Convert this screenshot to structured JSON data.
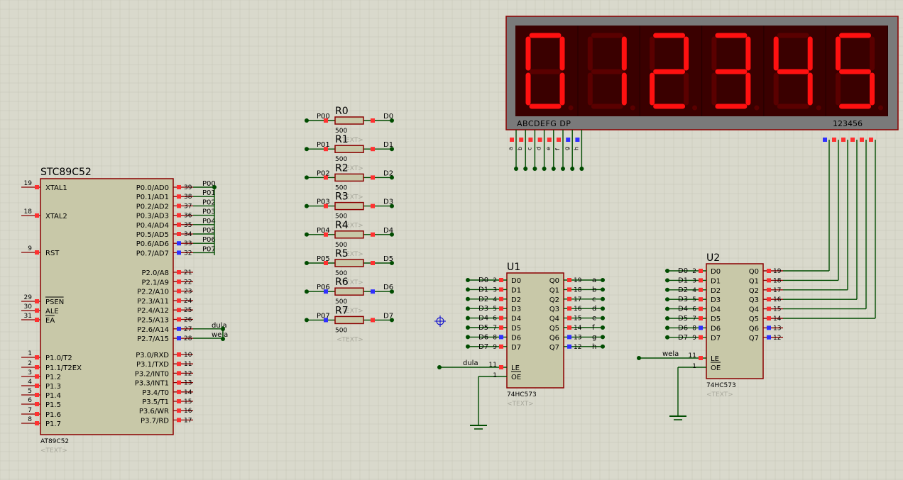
{
  "mcu": {
    "name": "STC89C52",
    "part": "AT89C52",
    "text": "<TEXT>",
    "left_pins": [
      {
        "num": "19",
        "label": "XTAL1"
      },
      {
        "num": "18",
        "label": "XTAL2"
      },
      {
        "num": "9",
        "label": "RST"
      },
      {
        "num": "29",
        "label": "PSEN",
        "overline": true
      },
      {
        "num": "30",
        "label": "ALE"
      },
      {
        "num": "31",
        "label": "EA",
        "overline": true
      },
      {
        "num": "1",
        "label": "P1.0/T2"
      },
      {
        "num": "2",
        "label": "P1.1/T2EX"
      },
      {
        "num": "3",
        "label": "P1.2"
      },
      {
        "num": "4",
        "label": "P1.3"
      },
      {
        "num": "5",
        "label": "P1.4"
      },
      {
        "num": "6",
        "label": "P1.5"
      },
      {
        "num": "7",
        "label": "P1.6"
      },
      {
        "num": "8",
        "label": "P1.7"
      }
    ],
    "right_pins": [
      {
        "num": "39",
        "label": "P0.0/AD0",
        "net": "P00"
      },
      {
        "num": "38",
        "label": "P0.1/AD1",
        "net": "P01"
      },
      {
        "num": "37",
        "label": "P0.2/AD2",
        "net": "P02"
      },
      {
        "num": "36",
        "label": "P0.3/AD3",
        "net": "P03"
      },
      {
        "num": "35",
        "label": "P0.4/AD4",
        "net": "P04"
      },
      {
        "num": "34",
        "label": "P0.5/AD5",
        "net": "P05"
      },
      {
        "num": "33",
        "label": "P0.6/AD6",
        "net": "P06"
      },
      {
        "num": "32",
        "label": "P0.7/AD7",
        "net": "P07"
      },
      {
        "num": "21",
        "label": "P2.0/A8",
        "net": ""
      },
      {
        "num": "22",
        "label": "P2.1/A9",
        "net": ""
      },
      {
        "num": "23",
        "label": "P2.2/A10",
        "net": ""
      },
      {
        "num": "24",
        "label": "P2.3/A11",
        "net": ""
      },
      {
        "num": "25",
        "label": "P2.4/A12",
        "net": ""
      },
      {
        "num": "26",
        "label": "P2.5/A13",
        "net": ""
      },
      {
        "num": "27",
        "label": "P2.6/A14",
        "net": "dula"
      },
      {
        "num": "28",
        "label": "P2.7/A15",
        "net": "wela"
      },
      {
        "num": "10",
        "label": "P3.0/RXD",
        "net": ""
      },
      {
        "num": "11",
        "label": "P3.1/TXD",
        "net": ""
      },
      {
        "num": "12",
        "label": "P3.2/INT0",
        "net": ""
      },
      {
        "num": "13",
        "label": "P3.3/INT1",
        "net": ""
      },
      {
        "num": "14",
        "label": "P3.4/T0",
        "net": ""
      },
      {
        "num": "15",
        "label": "P3.5/T1",
        "net": ""
      },
      {
        "num": "16",
        "label": "P3.6/WR",
        "net": ""
      },
      {
        "num": "17",
        "label": "P3.7/RD",
        "net": ""
      }
    ]
  },
  "resistors": [
    {
      "name": "R0",
      "value": "500",
      "in": "P00",
      "out": "D0"
    },
    {
      "name": "R1",
      "value": "500",
      "in": "P01",
      "out": "D1"
    },
    {
      "name": "R2",
      "value": "500",
      "in": "P02",
      "out": "D2"
    },
    {
      "name": "R3",
      "value": "500",
      "in": "P03",
      "out": "D3"
    },
    {
      "name": "R4",
      "value": "500",
      "in": "P04",
      "out": "D4"
    },
    {
      "name": "R5",
      "value": "500",
      "in": "P05",
      "out": "D5"
    },
    {
      "name": "R6",
      "value": "500",
      "in": "P06",
      "out": "D6"
    },
    {
      "name": "R7",
      "value": "500",
      "in": "P07",
      "out": "D7"
    }
  ],
  "latches": [
    {
      "ref": "U1",
      "part": "74HC573",
      "text": "<TEXT>",
      "le_net": "dula",
      "d_pins": [
        {
          "net": "D0",
          "num": "2",
          "label": "D0"
        },
        {
          "net": "D1",
          "num": "3",
          "label": "D1"
        },
        {
          "net": "D2",
          "num": "4",
          "label": "D2"
        },
        {
          "net": "D3",
          "num": "5",
          "label": "D3"
        },
        {
          "net": "D4",
          "num": "6",
          "label": "D4"
        },
        {
          "net": "D5",
          "num": "7",
          "label": "D5"
        },
        {
          "net": "D6",
          "num": "8",
          "label": "D6"
        },
        {
          "net": "D7",
          "num": "9",
          "label": "D7"
        }
      ],
      "q_pins": [
        {
          "num": "19",
          "label": "Q0",
          "net": "a"
        },
        {
          "num": "18",
          "label": "Q1",
          "net": "b"
        },
        {
          "num": "17",
          "label": "Q2",
          "net": "c"
        },
        {
          "num": "16",
          "label": "Q3",
          "net": "d"
        },
        {
          "num": "15",
          "label": "Q4",
          "net": "e"
        },
        {
          "num": "14",
          "label": "Q5",
          "net": "f"
        },
        {
          "num": "13",
          "label": "Q6",
          "net": "g"
        },
        {
          "num": "12",
          "label": "Q7",
          "net": "h"
        }
      ],
      "le": {
        "num": "11",
        "label": "LE"
      },
      "oe": {
        "num": "1",
        "label": "OE"
      }
    },
    {
      "ref": "U2",
      "part": "74HC573",
      "text": "<TEXT>",
      "le_net": "wela",
      "d_pins": [
        {
          "net": "D0",
          "num": "2",
          "label": "D0"
        },
        {
          "net": "D1",
          "num": "3",
          "label": "D1"
        },
        {
          "net": "D2",
          "num": "4",
          "label": "D2"
        },
        {
          "net": "D3",
          "num": "5",
          "label": "D3"
        },
        {
          "net": "D4",
          "num": "6",
          "label": "D4"
        },
        {
          "net": "D5",
          "num": "7",
          "label": "D5"
        },
        {
          "net": "D6",
          "num": "8",
          "label": "D6"
        },
        {
          "net": "D7",
          "num": "9",
          "label": "D7"
        }
      ],
      "q_pins": [
        {
          "num": "19",
          "label": "Q0",
          "net": ""
        },
        {
          "num": "18",
          "label": "Q1",
          "net": ""
        },
        {
          "num": "17",
          "label": "Q2",
          "net": ""
        },
        {
          "num": "16",
          "label": "Q3",
          "net": ""
        },
        {
          "num": "15",
          "label": "Q4",
          "net": ""
        },
        {
          "num": "14",
          "label": "Q5",
          "net": ""
        },
        {
          "num": "13",
          "label": "Q6",
          "net": ""
        },
        {
          "num": "12",
          "label": "Q7",
          "net": ""
        }
      ],
      "le": {
        "num": "11",
        "label": "LE"
      },
      "oe": {
        "num": "1",
        "label": "OE"
      }
    }
  ],
  "display": {
    "digits": [
      "0",
      "1",
      "2",
      "3",
      "4",
      "5"
    ],
    "segment_label": "ABCDEFG  DP",
    "digit_label": "123456",
    "seg_pins": [
      "a",
      "b",
      "c",
      "d",
      "e",
      "f",
      "g",
      "h"
    ]
  },
  "colors": {
    "background": "#d9d9cc",
    "grid": "#c6c6b8",
    "body_fill": "#c8c8a8",
    "body_border": "#8b0000",
    "wire": "#004c00",
    "pin_red": "#ff3030",
    "pin_blue": "#3030ff",
    "seg_on": "#ff1010",
    "seg_off": "#5a0000",
    "display_bg": "#3a0000",
    "display_frame": "#7a7a7a"
  }
}
